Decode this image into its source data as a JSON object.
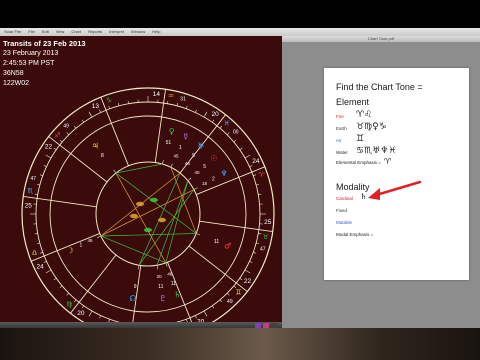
{
  "menubar": {
    "items": [
      "Solar Fire",
      "File",
      "Edit",
      "View",
      "Chart",
      "Reports",
      "Interpret",
      "Window",
      "Help"
    ]
  },
  "chart_window": {
    "title_line": "Transits of 23 Feb 2013",
    "date_line": "23 February 2013",
    "time_line": "2:45:53 PM PST",
    "lat_line": "36N58",
    "lon_line": "122W02"
  },
  "wheel": {
    "house_cusps": [
      {
        "deg": "14",
        "sign_glyph": "♒",
        "min": "31",
        "sign_color": "#e0a030"
      },
      {
        "deg": "20",
        "sign_glyph": "♓",
        "min": "00",
        "sign_color": "#3fb0ff"
      },
      {
        "deg": "24",
        "sign_glyph": "♈",
        "min": "",
        "sign_color": "#ff4040"
      },
      {
        "deg": "25",
        "sign_glyph": "♉",
        "min": "47",
        "sign_color": "#40c040"
      },
      {
        "deg": "22",
        "sign_glyph": "♊",
        "min": "49",
        "sign_color": "#e0e040"
      },
      {
        "deg": "20",
        "sign_glyph": "♋",
        "min": "",
        "sign_color": "#3fb0ff"
      },
      {
        "deg": "14",
        "sign_glyph": "♌",
        "min": "35",
        "sign_color": "#ff4040"
      },
      {
        "deg": "20",
        "sign_glyph": "♍",
        "min": "",
        "sign_color": "#40c040"
      },
      {
        "deg": "24",
        "sign_glyph": "♎",
        "min": "",
        "sign_color": "#e0e040"
      },
      {
        "deg": "25",
        "sign_glyph": "♏",
        "min": "47",
        "sign_color": "#3fb0ff"
      },
      {
        "deg": "22",
        "sign_glyph": "♐",
        "min": "49",
        "sign_color": "#ff4040"
      },
      {
        "deg": "13",
        "sign_glyph": "♑",
        "min": "",
        "sign_color": "#40c040"
      }
    ],
    "planets": [
      {
        "glyph": "♅",
        "deg": "5",
        "min": "48",
        "color": "#3fb0ff"
      },
      {
        "glyph": "☉",
        "deg": "5",
        "min": "40",
        "color": "#ff4040"
      },
      {
        "glyph": "♆",
        "deg": "2",
        "min": "18",
        "color": "#3fb0ff"
      },
      {
        "glyph": "☿",
        "deg": "1",
        "min": "45",
        "color": "#b070ff"
      },
      {
        "glyph": "♀",
        "deg": "51",
        "min": "",
        "color": "#40c040"
      },
      {
        "glyph": "♂",
        "deg": "11",
        "min": "",
        "color": "#ff4040"
      },
      {
        "glyph": "☽",
        "deg": "1",
        "min": "45",
        "color": "#e0e040"
      },
      {
        "glyph": "♃",
        "deg": "8",
        "min": "",
        "color": "#e0e040"
      },
      {
        "glyph": "♄",
        "deg": "11",
        "min": "46",
        "color": "#40c040"
      },
      {
        "glyph": "♇",
        "deg": "11",
        "min": "20",
        "color": "#b070ff"
      },
      {
        "glyph": "☊",
        "deg": "9",
        "min": "",
        "color": "#3fb0ff"
      }
    ],
    "degree_labels": [
      "13",
      "8",
      "51",
      "12",
      "7",
      "1",
      "46",
      "16",
      "20",
      "24",
      "25",
      "47",
      "11",
      "35",
      "9",
      "22",
      "51",
      "45",
      "5",
      "14"
    ]
  },
  "document": {
    "window_title": "Chart Tone.pdf",
    "heading_main": "Find the Chart Tone =",
    "heading_element": "Element",
    "element_rows": [
      {
        "label": "Fire",
        "color": "#d02020",
        "scribble": "♈♌"
      },
      {
        "label": "Earth",
        "color": "#3a3a3a",
        "scribble": "♉♍♀♑"
      },
      {
        "label": "Air",
        "color": "#3060d0",
        "scribble": "♊"
      },
      {
        "label": "Water",
        "color": "#2a2a2a",
        "scribble": "♋♏♅♆♓"
      }
    ],
    "elemental_emphasis": "Elemental Emphasis =",
    "elemental_emphasis_mark": "♈",
    "heading_modality": "Modality",
    "modality_rows": [
      {
        "label": "Cardinal",
        "color": "#d02020",
        "scribble": "♄"
      },
      {
        "label": "Fixed",
        "color": "#3a3a3a",
        "scribble": ""
      },
      {
        "label": "Mutable",
        "color": "#3060d0",
        "scribble": ""
      }
    ],
    "modal_emphasis": "Modal Emphasis ="
  },
  "colors": {
    "chart_bg": "#3b0a0a",
    "aspect_orange": "#e0a030",
    "aspect_green": "#40c040",
    "arrow_red": "#e02020"
  }
}
